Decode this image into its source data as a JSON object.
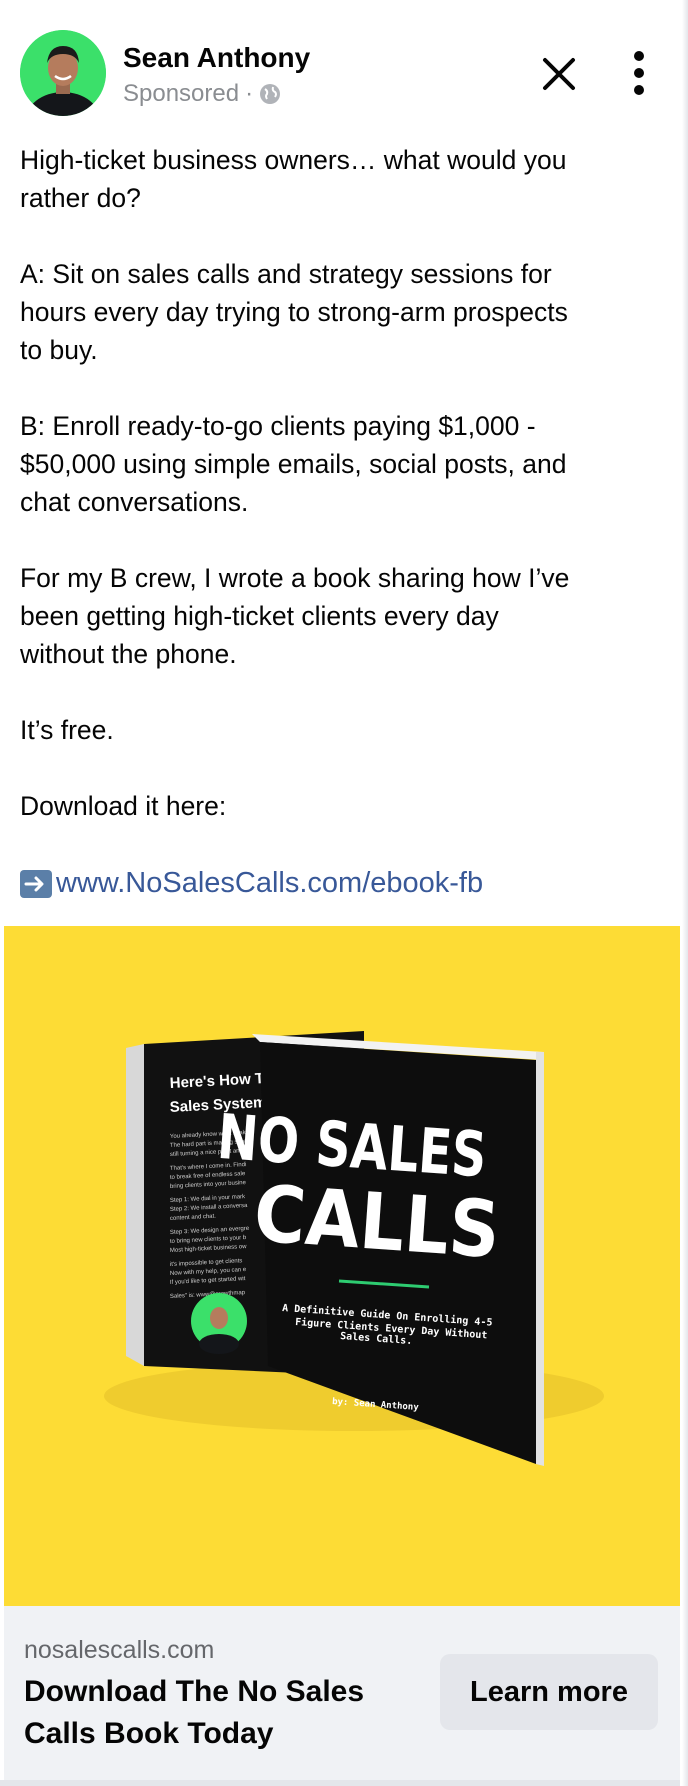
{
  "post": {
    "author": "Sean Anthony",
    "sponsored_label": "Sponsored",
    "separator": "·",
    "icons": {
      "avatar": "profile-photo",
      "privacy": "globe-icon",
      "close": "close-icon",
      "more": "more-options-icon",
      "link_arrow": "right-arrow-icon"
    },
    "paragraphs": [
      "High-ticket business owners… what would you\nrather do?",
      "A: Sit on sales calls and strategy sessions for\nhours every day trying to strong-arm prospects\nto buy.",
      "B: Enroll ready-to-go clients paying $1,000 -\n$50,000 using simple emails, social posts, and\nchat conversations.",
      "For my B crew, I wrote a book sharing how I’ve\nbeen getting high-ticket clients every day\nwithout the phone.",
      "It’s free.",
      "Download it here:"
    ],
    "link_text": "www.NoSalesCalls.com/ebook-fb"
  },
  "creative": {
    "background_color": "#fddc35",
    "back_cover": {
      "heading_line1": "Here's How To Get",
      "heading_line2": "Sales System...",
      "body_lines": [
        "You already know what it tak",
        "The hard part is making sure",
        "still turning a nice profit and f",
        "That's where I come in. Findi",
        "to break free of endless sale",
        "bring clients into your busine",
        "Step 1: We dial in your mark",
        "Step 2: We install a conversa",
        "content and chat.",
        "Step 3: We design an evergre",
        "to bring new clients to your b",
        "Most high-ticket business ow",
        "it's impossible to get clients",
        "Now with my help, you can e",
        "If you'd like to get started wit",
        "Sales\" is: www@growthmap"
      ]
    },
    "front_cover": {
      "title_line1": "NO SALES",
      "title_line2": "CALLS",
      "accent_color": "#2ecc71",
      "subtitle_line1": "A Definitive Guide On Enrolling 4-5",
      "subtitle_line2": "Figure Clients Every Day Without",
      "subtitle_line3": "Sales Calls.",
      "byline": "by: Sean Anthony"
    }
  },
  "footer": {
    "domain": "nosalescalls.com",
    "headline": "Download The No Sales Calls Book Today",
    "cta_label": "Learn more"
  }
}
